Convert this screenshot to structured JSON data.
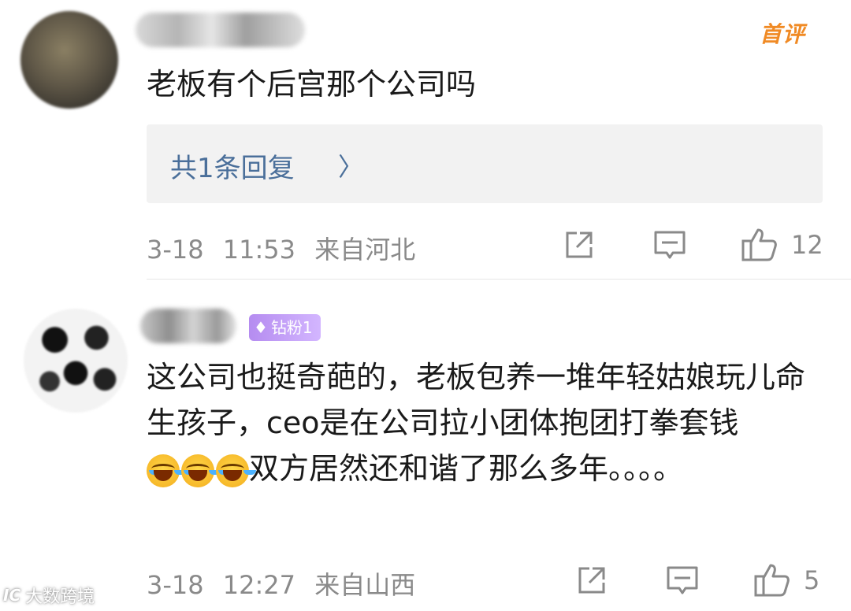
{
  "comments": [
    {
      "badge": "首评",
      "content": "老板有个后宫那个公司吗",
      "replies_label": "共1条回复",
      "replies_chevron": "〉",
      "date": "3-18",
      "time": "11:53",
      "location": "来自河北",
      "likes": "12"
    },
    {
      "fan_badge": "钻粉1",
      "content_before_emoji": "这公司也挺奇葩的，老板包养一堆年轻姑娘玩儿命生孩子，ceo是在公司拉小团体抱团打拳套钱",
      "emoji_names": [
        "laughing-crying-emoji",
        "laughing-crying-emoji",
        "laughing-crying-emoji"
      ],
      "content_after_emoji": "双方居然还和谐了那么多年。。。。",
      "date": "3-18",
      "time": "12:27",
      "location": "来自山西",
      "likes": "5"
    }
  ],
  "watermark": {
    "logo": "IC",
    "text": "大数跨境"
  },
  "colors": {
    "reply_link": "#4a6f9a",
    "meta_gray": "#8a8a8a",
    "first_comment_badge": "#f08a24",
    "fan_badge": "#b58cf0"
  },
  "icons": {
    "share": "share-icon",
    "comment": "comment-icon",
    "like": "thumbs-up-icon",
    "gem": "diamond-icon"
  }
}
